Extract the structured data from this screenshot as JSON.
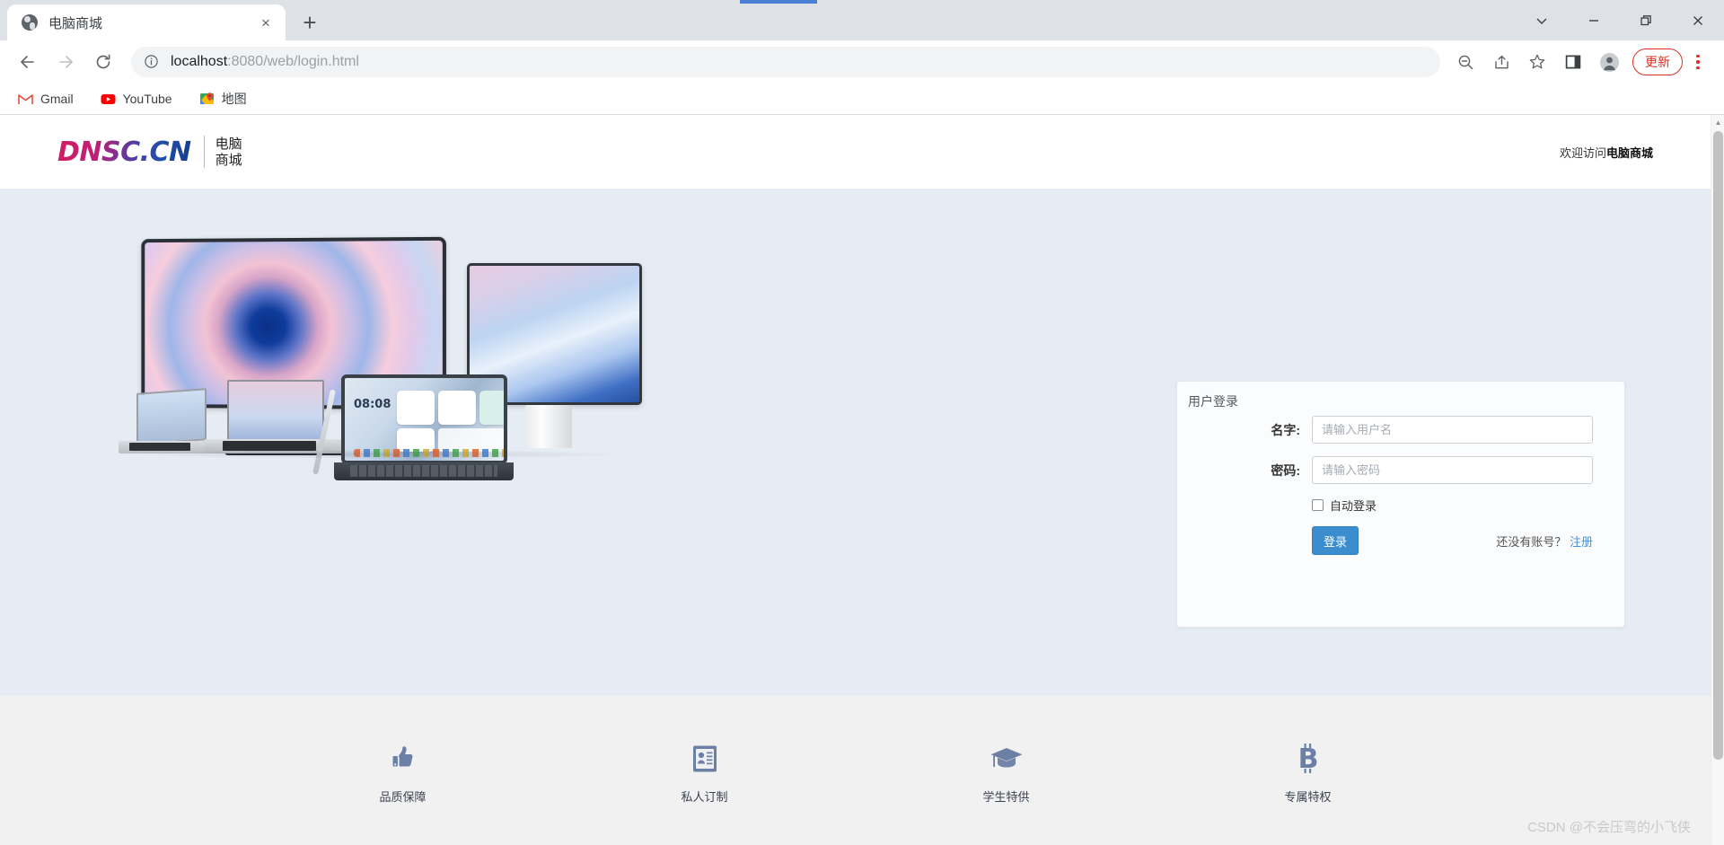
{
  "browser": {
    "tab": {
      "title": "电脑商城",
      "favicon": "globe-icon",
      "close": "×"
    },
    "new_tab_label": "+",
    "window_controls": {
      "tab_search": "tab-search-icon",
      "minimize": "minimize-icon",
      "maximize": "restore-icon",
      "close": "close-icon"
    },
    "nav": {
      "back": "back-arrow-icon",
      "forward": "forward-arrow-icon",
      "reload": "reload-icon"
    },
    "omnibox": {
      "info_icon": "info-circle-icon",
      "url_host": "localhost",
      "url_rest": ":8080/web/login.html",
      "full_url": "localhost:8080/web/login.html"
    },
    "toolbar_icons": [
      "zoom-out-icon",
      "share-icon",
      "bookmark-star-icon",
      "side-panel-icon",
      "profile-avatar-icon"
    ],
    "update_button": "更新",
    "menu_icon": "kebab-menu-icon",
    "bookmarks": [
      {
        "label": "Gmail",
        "icon": "gmail-icon"
      },
      {
        "label": "YouTube",
        "icon": "youtube-icon"
      },
      {
        "label": "地图",
        "icon": "google-maps-icon"
      }
    ]
  },
  "site": {
    "header": {
      "logo_text": "DNSC.CN",
      "logo_cn_line1": "电脑",
      "logo_cn_line2": "商城",
      "welcome_prefix": "欢迎访问",
      "welcome_brand": "电脑商城"
    },
    "hero": {
      "background_color": "#e6ecf4",
      "product_image_alt": "curved-monitor-laptops-tablet"
    },
    "login": {
      "panel_title": "用户登录",
      "name_label": "名字:",
      "name_placeholder": "请输入用户名",
      "name_value": "",
      "password_label": "密码:",
      "password_placeholder": "请输入密码",
      "password_value": "",
      "auto_login_label": "自动登录",
      "auto_login_checked": false,
      "submit_label": "登录",
      "register_prompt": "还没有账号？",
      "register_link": "注册",
      "button_color": "#3c8dcd",
      "link_color": "#4a90d9"
    },
    "features": [
      {
        "label": "品质保障",
        "icon": "thumbs-up-icon"
      },
      {
        "label": "私人订制",
        "icon": "id-card-icon"
      },
      {
        "label": "学生特供",
        "icon": "graduation-cap-icon"
      },
      {
        "label": "专属特权",
        "icon": "bitcoin-icon"
      }
    ],
    "feature_icon_color": "#6c7fa5",
    "watermark": "CSDN @不会压弯的小飞侠"
  }
}
